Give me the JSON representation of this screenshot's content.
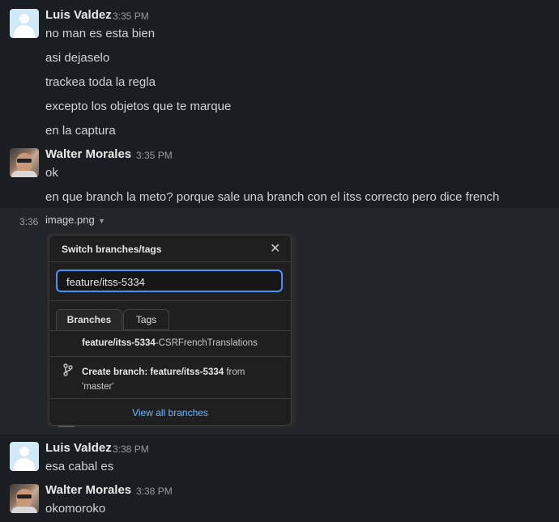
{
  "messages": [
    {
      "author": "Luis Valdez",
      "time": "3:35 PM",
      "lines": [
        "no man es esta bien",
        "asi dejaselo",
        "trackea toda la regla",
        "excepto los objetos que te marque",
        "en la captura"
      ]
    },
    {
      "author": "Walter Morales",
      "time": "3:35 PM",
      "lines": [
        "ok",
        "en que branch la meto? porque sale una branch con el itss correcto pero dice french"
      ]
    },
    {
      "author": "Luis Valdez",
      "time": "3:38 PM",
      "lines": [
        "esa cabal es"
      ]
    },
    {
      "author": "Walter Morales",
      "time": "3:38 PM",
      "lines": [
        "okomoroko"
      ]
    }
  ],
  "attachment": {
    "side_time": "3:36",
    "file_name": "image.png",
    "caret_icon": "caret-down-icon"
  },
  "popup": {
    "title": "Switch branches/tags",
    "close_icon": "close-icon",
    "search_value": "feature/itss-5334",
    "tabs": [
      "Branches",
      "Tags"
    ],
    "branch_match_bold": "feature/itss-5334",
    "branch_match_rest": "-CSRFrenchTranslations",
    "create_prefix": "Create branch: feature/itss-5334",
    "create_from": " from",
    "create_source": "'master'",
    "view_all": "View all branches"
  },
  "colors": {
    "background": "#1a1d21",
    "accent_link": "#6cb6ff",
    "focus_border": "#4493f8"
  }
}
